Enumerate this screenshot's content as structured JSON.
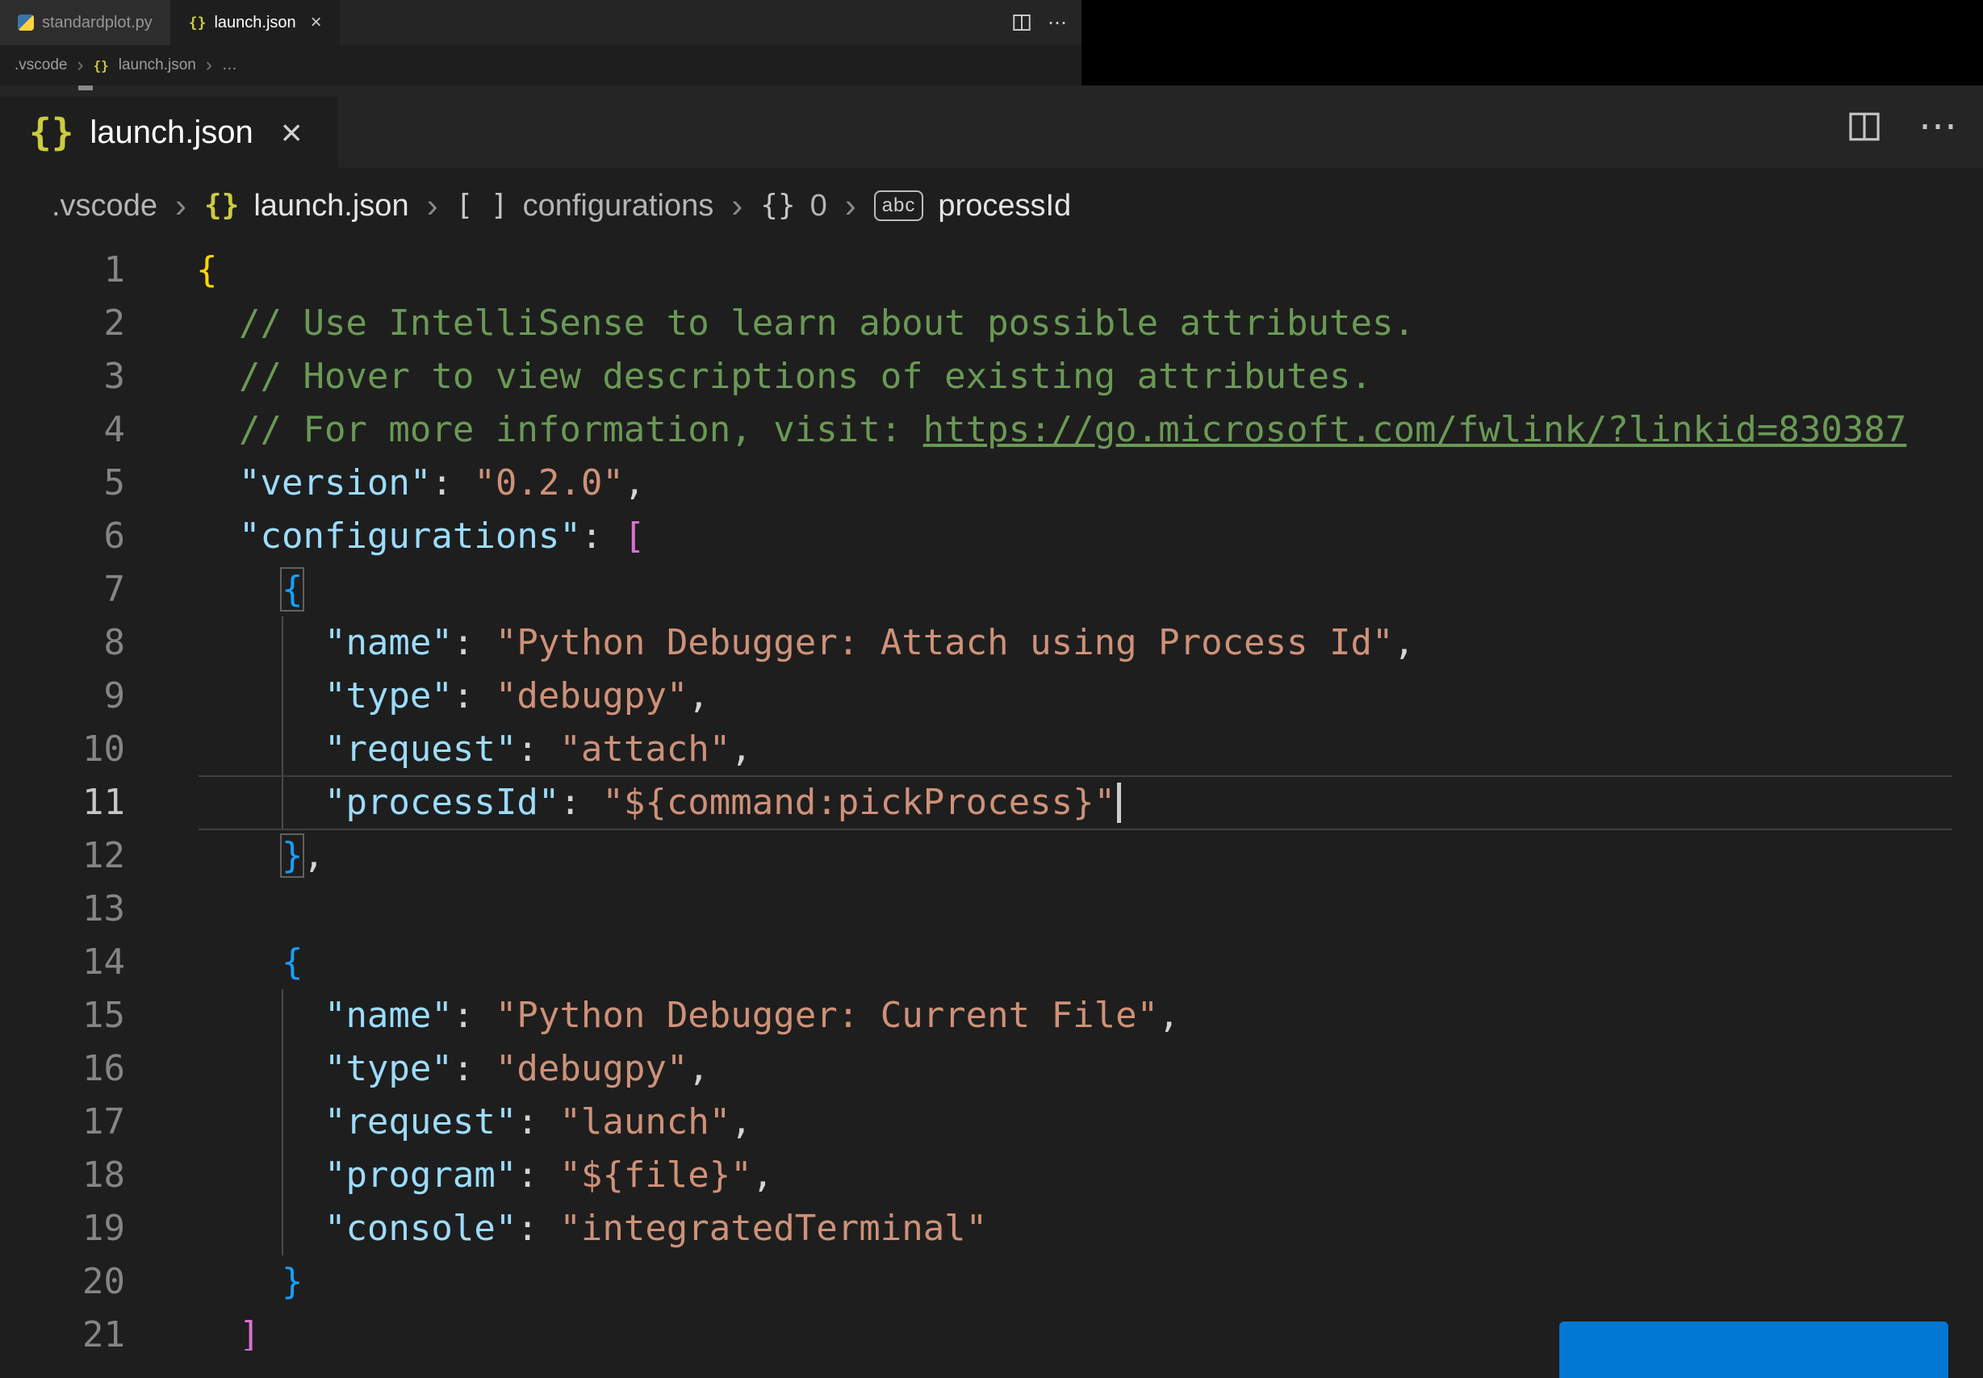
{
  "colors": {
    "editor_bg": "#1e1e1e",
    "tab_bar_bg": "#252526",
    "black_region": "#000000",
    "button_blue": "#0078d4",
    "comment_green": "#6a9955",
    "string_orange": "#ce9178",
    "key_blue": "#9cdcfe",
    "bracket_gold": "#ffd700",
    "bracket_pink": "#da70d6",
    "bracket_blue": "#179fff"
  },
  "icons": {
    "close": "×",
    "chevron": "›",
    "ellipsis": "⋯",
    "json_braces": "{}",
    "array_brackets": "[ ]",
    "abc": "abc"
  },
  "top_bar": {
    "tabs": [
      {
        "label": "standardplot.py",
        "icon": "python-icon",
        "active": false
      },
      {
        "label": "launch.json",
        "icon": "json-icon",
        "active": true
      }
    ]
  },
  "top_breadcrumb": {
    "folder": ".vscode",
    "file": "launch.json",
    "more": "…"
  },
  "zoom": {
    "tab": {
      "label": "launch.json"
    },
    "breadcrumb": {
      "items": [
        {
          "icon": "",
          "label": ".vscode"
        },
        {
          "icon": "{}",
          "label": "launch.json"
        },
        {
          "icon": "[ ]",
          "label": "configurations"
        },
        {
          "icon": "{}",
          "label": "0"
        },
        {
          "icon": "abc",
          "label": "processId"
        }
      ]
    },
    "code": {
      "active_line": 11,
      "lines": [
        {
          "n": 1,
          "t": [
            [
              "{",
              "b1"
            ]
          ]
        },
        {
          "n": 2,
          "t": [
            [
              "  // Use IntelliSense to learn about possible attributes.",
              "com"
            ]
          ]
        },
        {
          "n": 3,
          "t": [
            [
              "  // Hover to view descriptions of existing attributes.",
              "com"
            ]
          ]
        },
        {
          "n": 4,
          "t": [
            [
              "  // For more information, visit: ",
              "com"
            ],
            [
              "https://go.microsoft.com/fwlink/?linkid=830387",
              "link"
            ]
          ]
        },
        {
          "n": 5,
          "t": [
            [
              "  ",
              "pun"
            ],
            [
              "\"version\"",
              "key"
            ],
            [
              ": ",
              "pun"
            ],
            [
              "\"0.2.0\"",
              "str"
            ],
            [
              ",",
              "pun"
            ]
          ]
        },
        {
          "n": 6,
          "t": [
            [
              "  ",
              "pun"
            ],
            [
              "\"configurations\"",
              "key"
            ],
            [
              ": ",
              "pun"
            ],
            [
              "[",
              "b2"
            ]
          ]
        },
        {
          "n": 7,
          "t": [
            [
              "    ",
              "pun"
            ],
            [
              "{",
              "b3 match"
            ]
          ]
        },
        {
          "n": 8,
          "g": [
            4
          ],
          "t": [
            [
              "      ",
              "pun"
            ],
            [
              "\"name\"",
              "key"
            ],
            [
              ": ",
              "pun"
            ],
            [
              "\"Python Debugger: Attach using Process Id\"",
              "str"
            ],
            [
              ",",
              "pun"
            ]
          ]
        },
        {
          "n": 9,
          "g": [
            4
          ],
          "t": [
            [
              "      ",
              "pun"
            ],
            [
              "\"type\"",
              "key"
            ],
            [
              ": ",
              "pun"
            ],
            [
              "\"debugpy\"",
              "str"
            ],
            [
              ",",
              "pun"
            ]
          ]
        },
        {
          "n": 10,
          "g": [
            4
          ],
          "t": [
            [
              "      ",
              "pun"
            ],
            [
              "\"request\"",
              "key"
            ],
            [
              ": ",
              "pun"
            ],
            [
              "\"attach\"",
              "str"
            ],
            [
              ",",
              "pun"
            ]
          ]
        },
        {
          "n": 11,
          "g": [
            4
          ],
          "t": [
            [
              "      ",
              "pun"
            ],
            [
              "\"processId\"",
              "key"
            ],
            [
              ": ",
              "pun"
            ],
            [
              "\"${command:pickProcess}\"",
              "str"
            ],
            [
              "",
              "cur"
            ]
          ]
        },
        {
          "n": 12,
          "t": [
            [
              "    ",
              "pun"
            ],
            [
              "}",
              "b3 match"
            ],
            [
              ",",
              "pun"
            ]
          ]
        },
        {
          "n": 13,
          "t": []
        },
        {
          "n": 14,
          "t": [
            [
              "    ",
              "pun"
            ],
            [
              "{",
              "b3"
            ]
          ]
        },
        {
          "n": 15,
          "g": [
            4
          ],
          "t": [
            [
              "      ",
              "pun"
            ],
            [
              "\"name\"",
              "key"
            ],
            [
              ": ",
              "pun"
            ],
            [
              "\"Python Debugger: Current File\"",
              "str"
            ],
            [
              ",",
              "pun"
            ]
          ]
        },
        {
          "n": 16,
          "g": [
            4
          ],
          "t": [
            [
              "      ",
              "pun"
            ],
            [
              "\"type\"",
              "key"
            ],
            [
              ": ",
              "pun"
            ],
            [
              "\"debugpy\"",
              "str"
            ],
            [
              ",",
              "pun"
            ]
          ]
        },
        {
          "n": 17,
          "g": [
            4
          ],
          "t": [
            [
              "      ",
              "pun"
            ],
            [
              "\"request\"",
              "key"
            ],
            [
              ": ",
              "pun"
            ],
            [
              "\"launch\"",
              "str"
            ],
            [
              ",",
              "pun"
            ]
          ]
        },
        {
          "n": 18,
          "g": [
            4
          ],
          "t": [
            [
              "      ",
              "pun"
            ],
            [
              "\"program\"",
              "key"
            ],
            [
              ": ",
              "pun"
            ],
            [
              "\"${file}\"",
              "str"
            ],
            [
              ",",
              "pun"
            ]
          ]
        },
        {
          "n": 19,
          "g": [
            4
          ],
          "t": [
            [
              "      ",
              "pun"
            ],
            [
              "\"console\"",
              "key"
            ],
            [
              ": ",
              "pun"
            ],
            [
              "\"integratedTerminal\"",
              "str"
            ]
          ]
        },
        {
          "n": 20,
          "t": [
            [
              "    ",
              "pun"
            ],
            [
              "}",
              "b3"
            ]
          ]
        },
        {
          "n": 21,
          "t": [
            [
              "  ",
              "pun"
            ],
            [
              "]",
              "b2"
            ]
          ]
        }
      ]
    }
  }
}
